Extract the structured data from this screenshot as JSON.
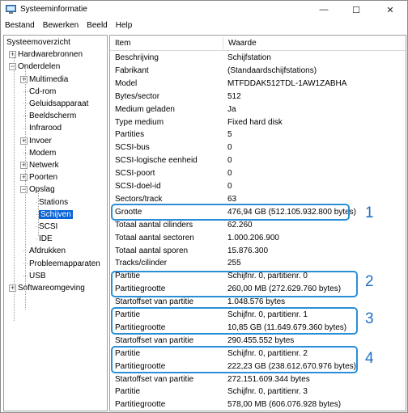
{
  "window": {
    "title": "Systeeminformatie",
    "min_label": "—",
    "max_label": "☐",
    "close_label": "✕"
  },
  "menu": [
    "Bestand",
    "Bewerken",
    "Beeld",
    "Help"
  ],
  "tree": [
    {
      "label": "Systeemoverzicht",
      "level": 0,
      "expander": ""
    },
    {
      "label": "Hardwarebronnen",
      "level": 1,
      "expander": "+"
    },
    {
      "label": "Onderdelen",
      "level": 1,
      "expander": "−"
    },
    {
      "label": "Multimedia",
      "level": 2,
      "expander": "+"
    },
    {
      "label": "Cd-rom",
      "level": 2,
      "expander": ""
    },
    {
      "label": "Geluidsapparaat",
      "level": 2,
      "expander": ""
    },
    {
      "label": "Beeldscherm",
      "level": 2,
      "expander": ""
    },
    {
      "label": "Infrarood",
      "level": 2,
      "expander": ""
    },
    {
      "label": "Invoer",
      "level": 2,
      "expander": "+"
    },
    {
      "label": "Modem",
      "level": 2,
      "expander": ""
    },
    {
      "label": "Netwerk",
      "level": 2,
      "expander": "+"
    },
    {
      "label": "Poorten",
      "level": 2,
      "expander": "+"
    },
    {
      "label": "Opslag",
      "level": 2,
      "expander": "−"
    },
    {
      "label": "Stations",
      "level": 3,
      "expander": ""
    },
    {
      "label": "Schijven",
      "level": 3,
      "expander": "",
      "selected": true
    },
    {
      "label": "SCSI",
      "level": 3,
      "expander": ""
    },
    {
      "label": "IDE",
      "level": 3,
      "expander": ""
    },
    {
      "label": "Afdrukken",
      "level": 2,
      "expander": ""
    },
    {
      "label": "Probleemapparaten",
      "level": 2,
      "expander": ""
    },
    {
      "label": "USB",
      "level": 2,
      "expander": ""
    },
    {
      "label": "Softwareomgeving",
      "level": 1,
      "expander": "+"
    }
  ],
  "list": {
    "col_item": "Item",
    "col_value": "Waarde",
    "rows": [
      [
        "Beschrijving",
        "Schijfstation"
      ],
      [
        "Fabrikant",
        "(Standaardschijfstations)"
      ],
      [
        "Model",
        "MTFDDAK512TDL-1AW1ZABHA"
      ],
      [
        "Bytes/sector",
        "512"
      ],
      [
        "Medium geladen",
        "Ja"
      ],
      [
        "Type medium",
        "Fixed hard disk"
      ],
      [
        "Partities",
        "5"
      ],
      [
        "SCSI-bus",
        "0"
      ],
      [
        "SCSI-logische eenheid",
        "0"
      ],
      [
        "SCSI-poort",
        "0"
      ],
      [
        "SCSI-doel-id",
        "0"
      ],
      [
        "Sectors/track",
        "63"
      ],
      [
        "Grootte",
        "476,94 GB (512.105.932.800 bytes)"
      ],
      [
        "Totaal aantal cilinders",
        "62.260"
      ],
      [
        "Totaal aantal sectoren",
        "1.000.206.900"
      ],
      [
        "Totaal aantal sporen",
        "15.876.300"
      ],
      [
        "Tracks/cilinder",
        "255"
      ],
      [
        "Partitie",
        "Schijfnr. 0, partitienr. 0"
      ],
      [
        "Partitiegrootte",
        "260,00 MB (272.629.760 bytes)"
      ],
      [
        "Startoffset van partitie",
        "1.048.576 bytes"
      ],
      [
        "Partitie",
        "Schijfnr. 0, partitienr. 1"
      ],
      [
        "Partitiegrootte",
        "10,85 GB (11.649.679.360 bytes)"
      ],
      [
        "Startoffset van partitie",
        "290.455.552 bytes"
      ],
      [
        "Partitie",
        "Schijfnr. 0, partitienr. 2"
      ],
      [
        "Partitiegrootte",
        "222,23 GB (238.612.670.976 bytes)"
      ],
      [
        "Startoffset van partitie",
        "272.151.609.344 bytes"
      ],
      [
        "Partitie",
        "Schijfnr. 0, partitienr. 3"
      ],
      [
        "Partitiegrootte",
        "578,00 MB (606.076.928 bytes)"
      ]
    ]
  },
  "annotations": [
    "1",
    "2",
    "3",
    "4"
  ],
  "colors": {
    "highlight": "#2a8fd6",
    "annotation_number": "#1f6fc4",
    "selection": "#0a64d8"
  }
}
